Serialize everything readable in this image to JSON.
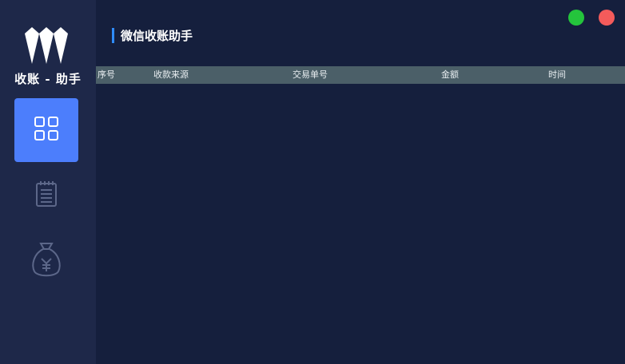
{
  "app": {
    "brand": "收账 - 助手",
    "title": "微信收账助手"
  },
  "sidebar": {
    "items": [
      {
        "id": "dashboard",
        "icon": "grid-icon",
        "active": true
      },
      {
        "id": "records",
        "icon": "notepad-icon",
        "active": false
      },
      {
        "id": "money",
        "icon": "money-bag-icon",
        "active": false
      }
    ]
  },
  "window_controls": {
    "green": "#24c43c",
    "red": "#f45b5b"
  },
  "table": {
    "columns": [
      "序号",
      "收款来源",
      "交易单号",
      "金额",
      "时间"
    ],
    "rows": []
  },
  "colors": {
    "background": "#151f3d",
    "sidebar": "#1e2849",
    "accent": "#4c7efc",
    "header_bg": "#4b5f68"
  }
}
